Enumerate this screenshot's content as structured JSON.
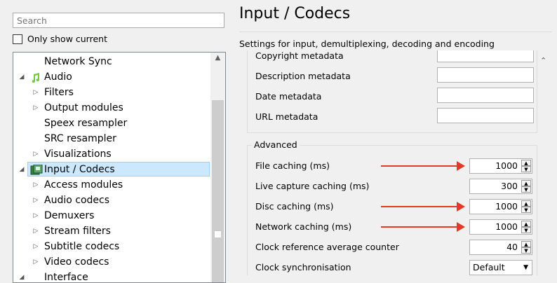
{
  "search": {
    "placeholder": "Search"
  },
  "only_show_current": {
    "label": "Only show current",
    "checked": false
  },
  "tree": {
    "items": [
      {
        "label": "Network Sync",
        "level": 1,
        "expander": "none"
      },
      {
        "label": "Audio",
        "level": 0,
        "expander": "expanded",
        "icon": "music-note-icon"
      },
      {
        "label": "Filters",
        "level": 1,
        "expander": "collapsed"
      },
      {
        "label": "Output modules",
        "level": 1,
        "expander": "collapsed"
      },
      {
        "label": "Speex resampler",
        "level": 1,
        "expander": "none"
      },
      {
        "label": "SRC resampler",
        "level": 1,
        "expander": "none"
      },
      {
        "label": "Visualizations",
        "level": 1,
        "expander": "collapsed"
      },
      {
        "label": "Input / Codecs",
        "level": 0,
        "expander": "expanded",
        "icon": "codecs-icon",
        "selected": true
      },
      {
        "label": "Access modules",
        "level": 1,
        "expander": "collapsed"
      },
      {
        "label": "Audio codecs",
        "level": 1,
        "expander": "collapsed"
      },
      {
        "label": "Demuxers",
        "level": 1,
        "expander": "collapsed"
      },
      {
        "label": "Stream filters",
        "level": 1,
        "expander": "collapsed"
      },
      {
        "label": "Subtitle codecs",
        "level": 1,
        "expander": "collapsed"
      },
      {
        "label": "Video codecs",
        "level": 1,
        "expander": "collapsed"
      },
      {
        "label": "Interface",
        "level": 0,
        "expander": "expanded"
      }
    ]
  },
  "panel": {
    "title": "Input / Codecs",
    "description": "Settings for input, demultiplexing, decoding and encoding"
  },
  "metadata_rows": [
    {
      "label": "Copyright metadata",
      "value": ""
    },
    {
      "label": "Description metadata",
      "value": ""
    },
    {
      "label": "Date metadata",
      "value": ""
    },
    {
      "label": "URL metadata",
      "value": ""
    }
  ],
  "advanced": {
    "title": "Advanced",
    "rows": [
      {
        "label": "File caching (ms)",
        "value": "1000",
        "kind": "spin",
        "highlighted": true
      },
      {
        "label": "Live capture caching (ms)",
        "value": "300",
        "kind": "spin",
        "highlighted": false
      },
      {
        "label": "Disc caching (ms)",
        "value": "1000",
        "kind": "spin",
        "highlighted": true
      },
      {
        "label": "Network caching (ms)",
        "value": "1000",
        "kind": "spin",
        "highlighted": true
      },
      {
        "label": "Clock reference average counter",
        "value": "40",
        "kind": "spin",
        "highlighted": false
      },
      {
        "label": "Clock synchronisation",
        "value": "Default",
        "kind": "combo",
        "highlighted": false
      }
    ]
  },
  "colors": {
    "annotation_arrow": "#e53a22",
    "selection": "#cce8ff",
    "audio_icon": "#7ac943"
  }
}
